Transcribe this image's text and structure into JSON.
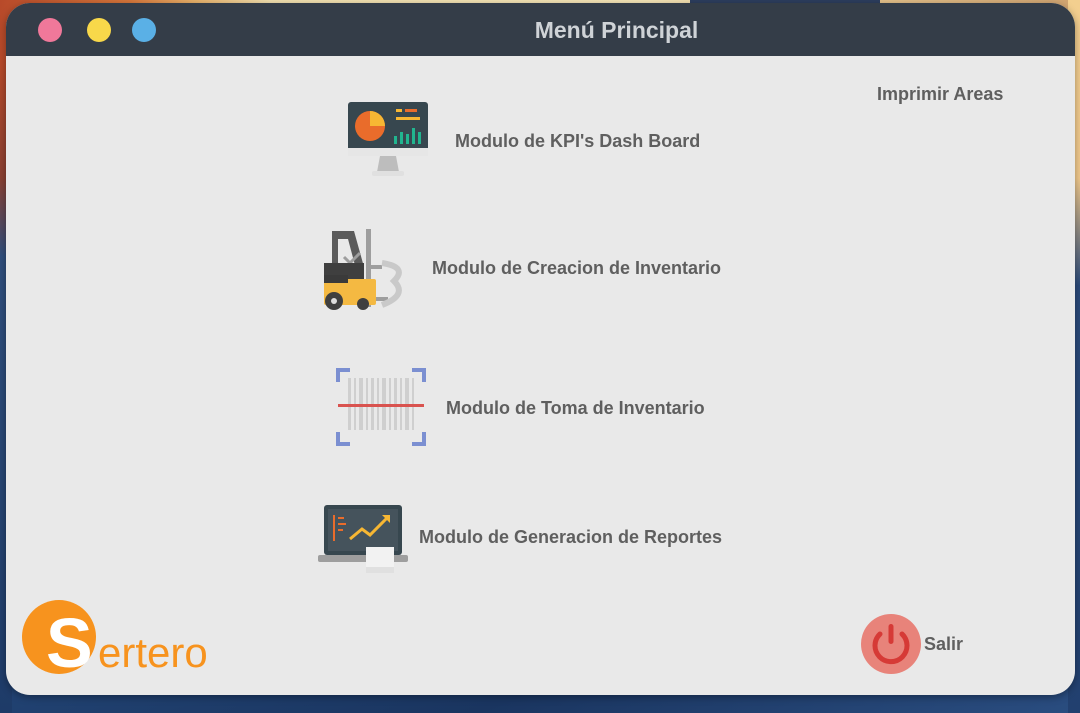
{
  "window": {
    "title": "Menú Principal"
  },
  "header": {
    "print_areas_label": "Imprimir Areas"
  },
  "menu": {
    "items": [
      {
        "label": "Modulo de KPI's Dash Board",
        "icon": "dashboard-monitor-icon"
      },
      {
        "label": "Modulo de Creacion de Inventario",
        "icon": "forklift-icon"
      },
      {
        "label": "Modulo de Toma de Inventario",
        "icon": "barcode-scanner-icon"
      },
      {
        "label": "Modulo de Generacion de Reportes",
        "icon": "laptop-report-icon"
      }
    ]
  },
  "brand": {
    "logo_letter": "S",
    "logo_text": "ertero",
    "color": "#f7931e"
  },
  "footer": {
    "exit_label": "Salir",
    "exit_icon": "power-icon"
  },
  "colors": {
    "titlebar": "#343d48",
    "close": "#f0789a",
    "minimize": "#f8d84a",
    "maximize": "#5ab0e6",
    "power": "#e8837a"
  }
}
